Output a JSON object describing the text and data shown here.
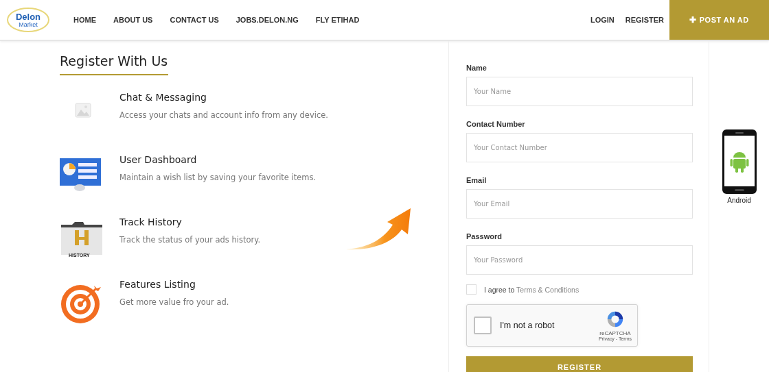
{
  "header": {
    "logo": {
      "name": "Delon",
      "tagline": "Market"
    },
    "nav": [
      {
        "label": "HOME"
      },
      {
        "label": "ABOUT US"
      },
      {
        "label": "CONTACT US"
      },
      {
        "label": "JOBS.DELON.NG"
      },
      {
        "label": "FLY ETIHAD"
      }
    ],
    "account_links": [
      {
        "label": "LOGIN"
      },
      {
        "label": "REGISTER"
      }
    ],
    "post_button": {
      "icon": "✚",
      "label": "POST AN AD"
    }
  },
  "intro": {
    "title": "Register With Us",
    "features": [
      {
        "kind": "image",
        "title": "Chat & Messaging",
        "description": "Access your chats and account info from any device."
      },
      {
        "kind": "dashboard",
        "title": "User Dashboard",
        "description": "Maintain a wish list by saving your favorite items."
      },
      {
        "kind": "history",
        "title": "Track History",
        "description": "Track the status of your ads history.",
        "icon_text": "HISTORY"
      },
      {
        "kind": "target",
        "title": "Features Listing",
        "description": "Get more value fro your ad."
      }
    ]
  },
  "form": {
    "fields": [
      {
        "label": "Name",
        "placeholder": "Your Name"
      },
      {
        "label": "Contact Number",
        "placeholder": "Your Contact Number"
      },
      {
        "label": "Email",
        "placeholder": "Your Email"
      },
      {
        "label": "Password",
        "placeholder": "Your Password"
      }
    ],
    "terms": {
      "checked": false,
      "text": "I agree to",
      "link": "Terms & Conditions"
    },
    "captcha": {
      "checked": false,
      "label": "I'm not a robot",
      "brand": "reCAPTCHA",
      "links": "Privacy - Terms"
    },
    "submit": "REGISTER"
  },
  "app_badge": {
    "label": "Android"
  }
}
